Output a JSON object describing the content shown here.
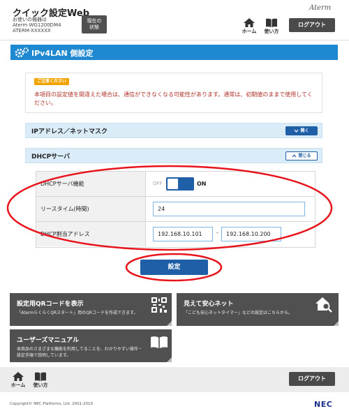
{
  "header": {
    "app_title": "クイック設定Web",
    "device_label": "お使いの機器は",
    "device_model": "Aterm WG1200DM4",
    "device_serial": "ATERM-XXXXXX",
    "status_button": "現在の\n状態",
    "brand": "Aterm",
    "nav_home": "ホーム",
    "nav_manual": "使い方",
    "logout": "ログアウト"
  },
  "page": {
    "title": "IPv4LAN 側設定"
  },
  "notice": {
    "badge": "ご注意ください",
    "text": "本項目の設定値を間違えた場合は、通信ができなくなる可能性があります。通常は、初期値のままで使用してください。"
  },
  "sections": {
    "ip_mask": {
      "title": "IPアドレス／ネットマスク",
      "button": "開く"
    },
    "dhcp": {
      "title": "DHCPサーバ",
      "button": "閉じる"
    }
  },
  "dhcp_settings": {
    "function_label": "DHCPサーバ機能",
    "toggle_off": "OFF",
    "toggle_on": "ON",
    "lease_label": "リースタイム(時間)",
    "lease_value": "24",
    "range_label": "DHCP割当アドレス",
    "range_start": "192.168.10.101",
    "range_separator": "-",
    "range_end": "192.168.10.200"
  },
  "submit_button": "設定",
  "tiles": {
    "qr": {
      "title": "設定用QRコードを表示",
      "desc": "「AtermらくらくQRスタート」用のQRコードを作成できます。"
    },
    "safety": {
      "title": "見えて安心ネット",
      "desc": "「こども安心ネットタイマー」などの設定はこちらから。"
    },
    "manual": {
      "title": "ユーザーズマニュアル",
      "desc": "本商品のさまざまな機能を利用してることを、わかりやすい操作・設定手順で説明しています。"
    }
  },
  "footer": {
    "nav_home": "ホーム",
    "nav_manual": "使い方",
    "logout": "ログアウト",
    "copyright": "Copyright© NEC Platforms, Ltd. 2001-2019",
    "logo": "NEC"
  },
  "colors": {
    "accent_blue": "#1e88d0",
    "button_blue": "#1f5fa8",
    "tile_gray": "#505050",
    "annotation_red": "#e8141c",
    "warning_text": "#b0332a",
    "badge_orange": "#f1a300"
  },
  "icons": [
    "gear-icon",
    "home-icon",
    "book-icon",
    "chevron-down-icon",
    "chevron-up-icon",
    "qr-code-icon",
    "house-search-icon",
    "open-book-icon"
  ]
}
